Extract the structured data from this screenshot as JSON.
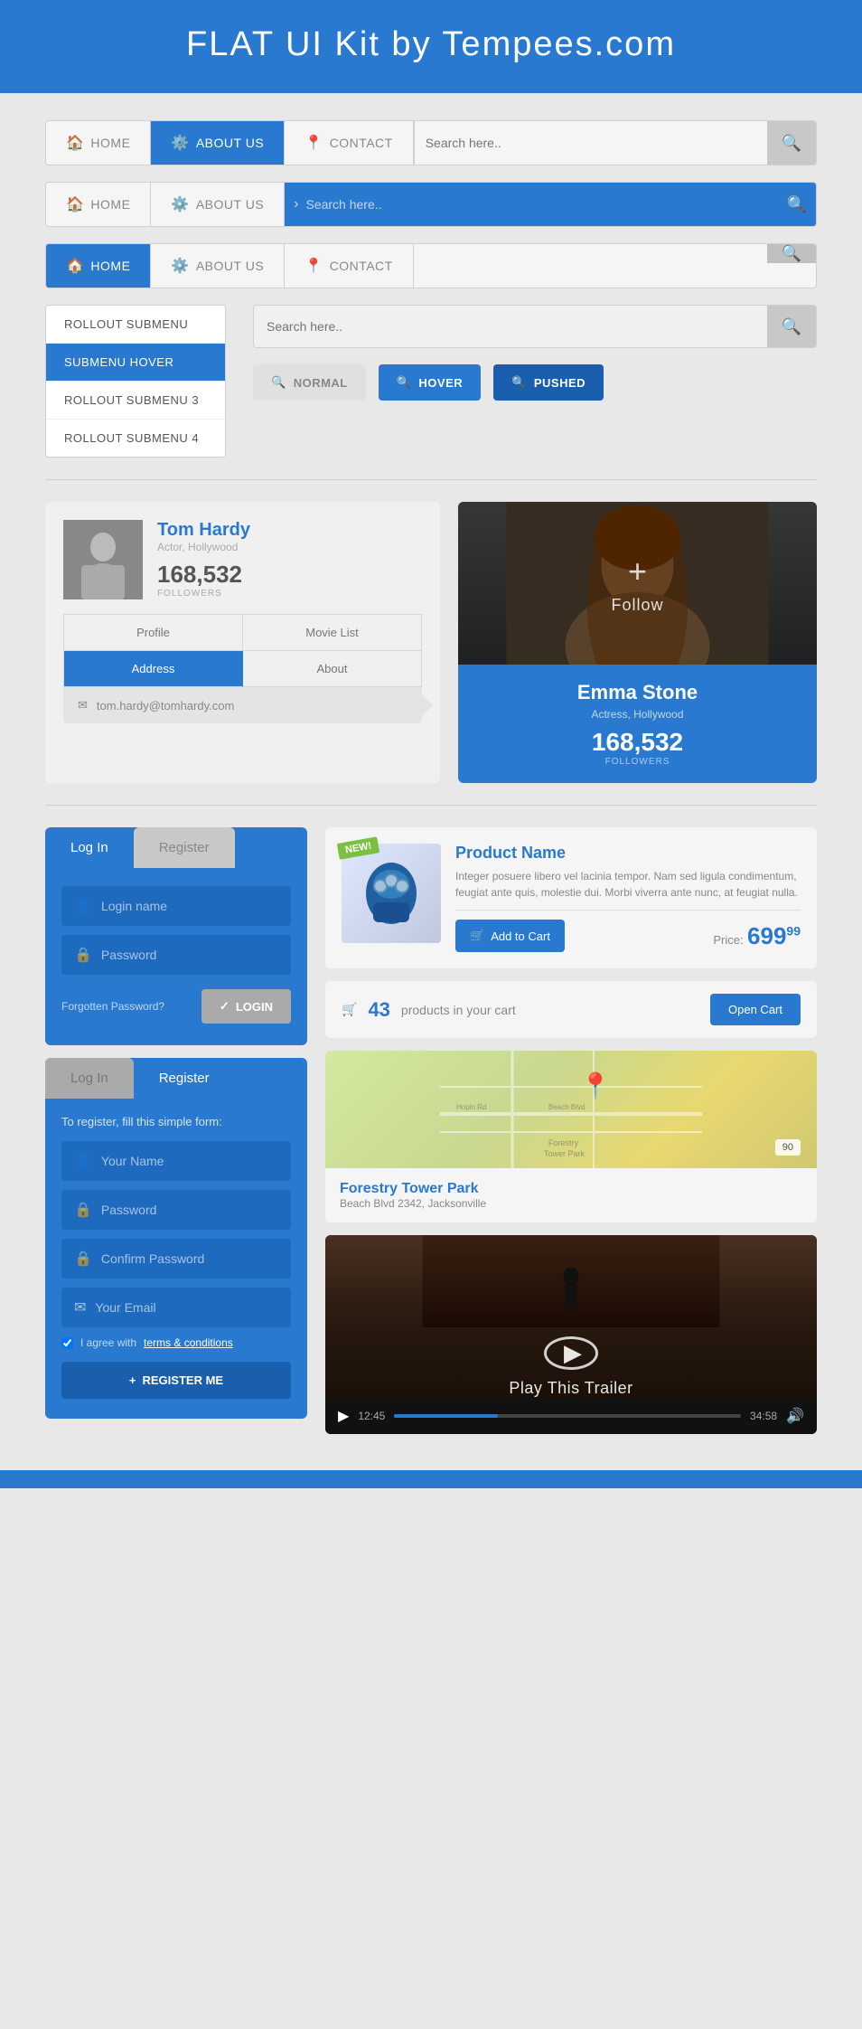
{
  "header": {
    "title": "FLAT UI Kit by Tempees.com"
  },
  "nav1": {
    "items": [
      {
        "label": "HOME",
        "icon": "🏠",
        "active": false
      },
      {
        "label": "ABOUT US",
        "icon": "⚙️",
        "active": true
      },
      {
        "label": "CONTACT",
        "icon": "📍",
        "active": false
      }
    ],
    "search_placeholder": "Search here.."
  },
  "nav2": {
    "items": [
      {
        "label": "HOME",
        "icon": "🏠"
      },
      {
        "label": "ABOUT US",
        "icon": "⚙️"
      }
    ],
    "search_placeholder": "Search here.."
  },
  "nav3": {
    "items": [
      {
        "label": "HOME",
        "icon": "🏠",
        "active": true
      },
      {
        "label": "ABOUT US",
        "icon": "⚙️"
      },
      {
        "label": "CONTACT",
        "icon": "📍"
      }
    ]
  },
  "submenu": {
    "items": [
      {
        "label": "ROLLOUT SUBMENU",
        "active": false
      },
      {
        "label": "SUBMENU HOVER",
        "active": true
      },
      {
        "label": "ROLLOUT SUBMENU 3",
        "active": false
      },
      {
        "label": "ROLLOUT SUBMENU 4",
        "active": false
      }
    ]
  },
  "search_buttons": {
    "normal_label": "NORMAL",
    "hover_label": "HOVER",
    "pushed_label": "PUSHED",
    "placeholder": "Search here.."
  },
  "profile_tom": {
    "name": "Tom Hardy",
    "subtitle": "Actor, Hollywood",
    "followers": "168,532",
    "followers_label": "FOLLOWERS",
    "tabs": [
      "Profile",
      "Movie List",
      "Address",
      "About"
    ],
    "active_tab": "Address",
    "email": "tom.hardy@tomhardy.com"
  },
  "profile_emma": {
    "name": "Emma Stone",
    "subtitle": "Actress, Hollywood",
    "followers": "168,532",
    "followers_label": "FOLLOWERS",
    "follow_label": "Follow"
  },
  "login": {
    "tab_login": "Log In",
    "tab_register": "Register",
    "login_placeholder": "Login name",
    "password_placeholder": "Password",
    "forgotten_label": "Forgotten Password?",
    "login_btn": "LOGIN"
  },
  "register": {
    "tab_login": "Log In",
    "tab_register": "Register",
    "note": "To register, fill this simple form:",
    "name_placeholder": "Your Name",
    "password_placeholder": "Password",
    "confirm_placeholder": "Confirm Password",
    "email_placeholder": "Your Email",
    "terms_text": "I agree with",
    "terms_link": "terms & conditions",
    "register_btn": "REGISTER ME"
  },
  "product": {
    "badge": "NEW!",
    "name": "Product Name",
    "description": "Integer posuere libero vel lacinia tempor. Nam sed ligula condimentum, feugiat ante quis, molestie dui. Morbi viverra ante nunc, at feugiat nulla.",
    "add_to_cart": "Add to Cart",
    "price_label": "Price:",
    "price_main": "699",
    "price_cents": "99"
  },
  "cart": {
    "count": "43",
    "text": "products in your cart",
    "btn": "Open Cart"
  },
  "map": {
    "place_name": "Forestry Tower Park",
    "address": "Beach Blvd 2342, Jacksonville"
  },
  "video": {
    "title": "Play This Trailer",
    "time_current": "12:45",
    "time_total": "34:58",
    "progress_pct": 30
  },
  "colors": {
    "blue": "#2979d0",
    "blue_dark": "#1a5fad",
    "gray": "#e8e8e8",
    "input_bg": "#1e6abf"
  }
}
